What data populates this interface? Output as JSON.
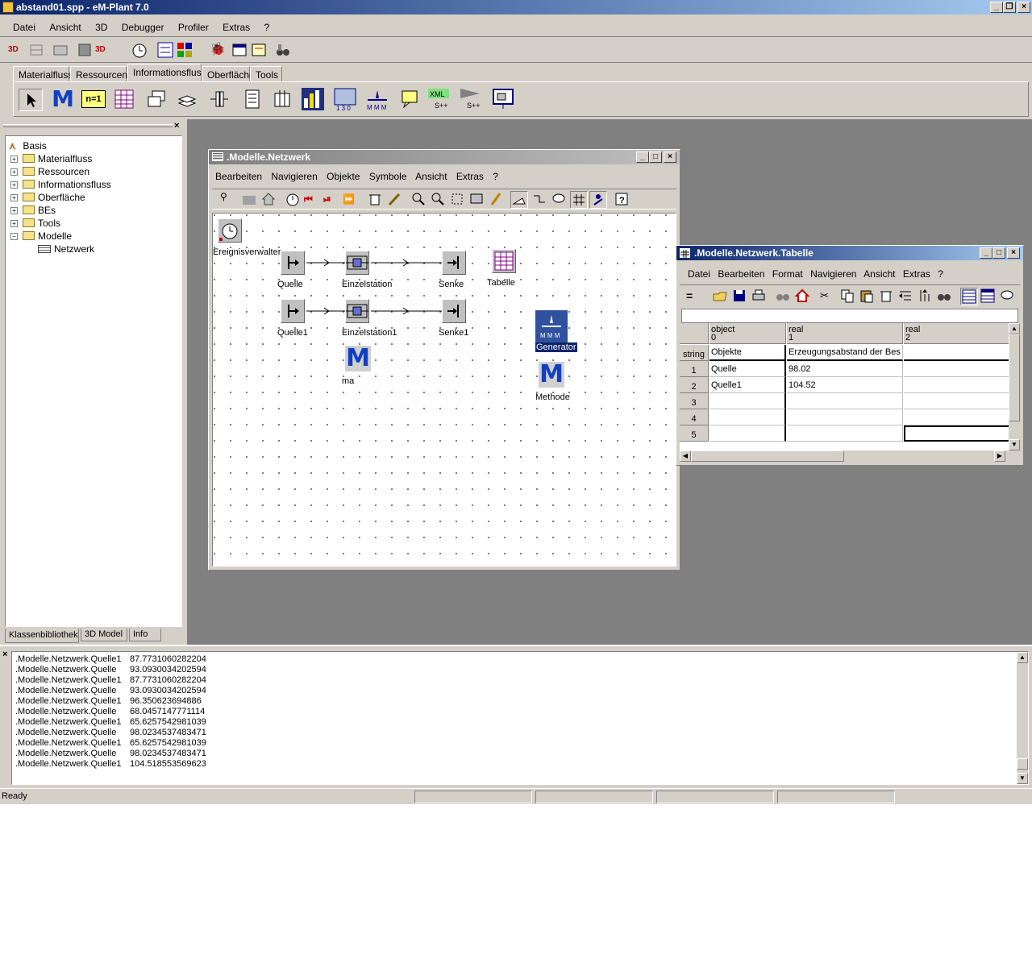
{
  "app": {
    "title": "abstand01.spp - eM-Plant 7.0"
  },
  "menu": [
    "Datei",
    "Ansicht",
    "3D",
    "Debugger",
    "Profiler",
    "Extras",
    "?"
  ],
  "tabs": [
    "Materialfluss",
    "Ressourcen",
    "Informationsfluss",
    "Oberfläche",
    "Tools"
  ],
  "active_tab": "Informationsfluss",
  "tree": {
    "root": "Basis",
    "items": [
      "Materialfluss",
      "Ressourcen",
      "Informationsfluss",
      "Oberfläche",
      "BEs",
      "Tools",
      "Modelle"
    ],
    "child": "Netzwerk"
  },
  "left_tabs": [
    "Klassenbibliothek",
    "3D Model",
    "Info"
  ],
  "network": {
    "title": ".Modelle.Netzwerk",
    "menu": [
      "Bearbeiten",
      "Navigieren",
      "Objekte",
      "Symbole",
      "Ansicht",
      "Extras",
      "?"
    ],
    "nodes": {
      "ereignis": "Ereignisverwalter",
      "quelle": "Quelle",
      "einzel": "Einzelstation",
      "senke": "Senke",
      "tabelle": "Tabelle",
      "quelle1": "Quelle1",
      "einzel1": "Einzelstation1",
      "senke1": "Senke1",
      "ma": "ma",
      "generator": "Generator",
      "methode": "Methode"
    }
  },
  "table": {
    "title": ".Modelle.Netzwerk.Tabelle",
    "menu": [
      "Datei",
      "Bearbeiten",
      "Format",
      "Navigieren",
      "Ansicht",
      "Extras",
      "?"
    ],
    "col_types": [
      "object",
      "real",
      "real"
    ],
    "col_nums": [
      "0",
      "1",
      "2"
    ],
    "row_header_label": "string",
    "header_row": {
      "c0": "Objekte",
      "c1": "Erzeugungsabstand der Bes"
    },
    "rows": [
      {
        "n": "1",
        "c0": "Quelle",
        "c1": "98.02"
      },
      {
        "n": "2",
        "c0": "Quelle1",
        "c1": "104.52"
      },
      {
        "n": "3",
        "c0": "",
        "c1": ""
      },
      {
        "n": "4",
        "c0": "",
        "c1": ""
      },
      {
        "n": "5",
        "c0": "",
        "c1": ""
      }
    ]
  },
  "console": [
    {
      "name": ".Modelle.Netzwerk.Quelle1",
      "value": "87.7731060282204"
    },
    {
      "name": ".Modelle.Netzwerk.Quelle",
      "value": "93.0930034202594"
    },
    {
      "name": ".Modelle.Netzwerk.Quelle1",
      "value": "87.7731060282204"
    },
    {
      "name": ".Modelle.Netzwerk.Quelle",
      "value": "93.0930034202594"
    },
    {
      "name": ".Modelle.Netzwerk.Quelle1",
      "value": "96.350623694886"
    },
    {
      "name": ".Modelle.Netzwerk.Quelle",
      "value": "68.0457147771114"
    },
    {
      "name": ".Modelle.Netzwerk.Quelle1",
      "value": "65.6257542981039"
    },
    {
      "name": ".Modelle.Netzwerk.Quelle",
      "value": "98.0234537483471"
    },
    {
      "name": ".Modelle.Netzwerk.Quelle1",
      "value": "65.6257542981039"
    },
    {
      "name": ".Modelle.Netzwerk.Quelle",
      "value": "98.0234537483471"
    },
    {
      "name": ".Modelle.Netzwerk.Quelle1",
      "value": "104.518553569623"
    }
  ],
  "status": {
    "text": "Ready"
  },
  "icons": {
    "main_toolbar": [
      "3d-icon",
      "3d-grid-icon",
      "3d-view-icon",
      "3d-box-icon",
      "3d-log-icon",
      "clock-icon",
      "network-icon",
      "color-grid-icon",
      "bug-icon",
      "window-icon",
      "tree-icon",
      "binoculars-icon"
    ],
    "palette": [
      "pointer-icon",
      "method-icon",
      "variable-icon",
      "table-icon",
      "frame-stack-icon",
      "layers-icon",
      "connector-icon",
      "list-icon",
      "grid-icon",
      "chart-icon",
      "counter-icon",
      "generator-icon",
      "comment-icon",
      "xml-icon",
      "sockets-icon",
      "display-icon"
    ]
  }
}
